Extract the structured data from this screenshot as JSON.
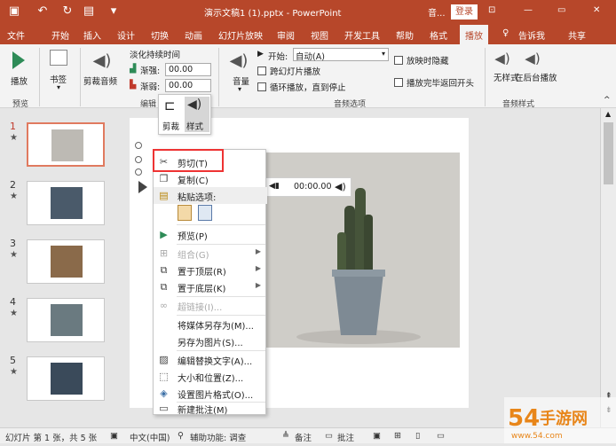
{
  "titlebar": {
    "doc_title": "演示文稿1 (1).pptx - PowerPoint",
    "tools_label": "音...",
    "login": "登录",
    "min": "—",
    "restore": "▭",
    "close": "✕"
  },
  "tabs": [
    "文件",
    "开始",
    "插入",
    "设计",
    "切换",
    "动画",
    "幻灯片放映",
    "审阅",
    "视图",
    "开发工具",
    "帮助",
    "格式",
    "播放"
  ],
  "tell_me": "告诉我",
  "share": "共享",
  "ribbon": {
    "play": "播放",
    "bookmark": "书签",
    "trim": "剪裁音频",
    "fade_title": "淡化持续时间",
    "fade_in": "渐强:",
    "fade_out": "渐弱:",
    "fade_in_value": "00.00",
    "fade_out_value": "00.00",
    "volume": "音量",
    "start_label": "开始:",
    "start_value": "自动(A)",
    "cross_slides": "跨幻灯片播放",
    "loop": "循环播放，直到停止",
    "hide": "放映时隐藏",
    "rewind": "播放完毕返回开头",
    "no_style": "无样式",
    "play_bg": "在后台播放",
    "group_preview": "预览",
    "group_edit": "编辑",
    "group_audio_options": "音频选项",
    "group_audio_style": "音频样式"
  },
  "mini_toolbar": {
    "crop": "剪裁",
    "style": "样式"
  },
  "slides": [
    {
      "num": "1",
      "mark": "★"
    },
    {
      "num": "2",
      "mark": "★"
    },
    {
      "num": "3",
      "mark": "★"
    },
    {
      "num": "4",
      "mark": "★"
    },
    {
      "num": "5",
      "mark": "★"
    }
  ],
  "media": {
    "time": "00:00.00"
  },
  "context_menu": [
    {
      "label": "剪切(T)",
      "icon": "scissors-icon"
    },
    {
      "label": "复制(C)",
      "icon": "copy-icon"
    },
    {
      "label": "粘贴选项:",
      "icon": "paste-icon"
    },
    {
      "label": "预览(P)",
      "icon": "play-icon"
    },
    {
      "label": "组合(G)",
      "icon": "group-icon"
    },
    {
      "label": "置于顶层(R)",
      "icon": "bring-front-icon"
    },
    {
      "label": "置于底层(K)",
      "icon": "send-back-icon"
    },
    {
      "label": "超链接(I)...",
      "icon": "link-icon"
    },
    {
      "label": "将媒体另存为(M)...",
      "icon": ""
    },
    {
      "label": "另存为图片(S)...",
      "icon": ""
    },
    {
      "label": "编辑替换文字(A)...",
      "icon": "alt-text-icon"
    },
    {
      "label": "大小和位置(Z)...",
      "icon": "size-icon"
    },
    {
      "label": "设置图片格式(O)...",
      "icon": "format-icon"
    },
    {
      "label": "新建批注(M)",
      "icon": "comment-icon"
    }
  ],
  "status": {
    "slide_info": "幻灯片 第 1 张，共 5 张",
    "lang": "中文(中国)",
    "accessibility": "辅助功能: 调查",
    "notes": "备注",
    "comments": "批注"
  },
  "watermark": {
    "text": "54手游网",
    "sub": "www.54.com"
  },
  "colors": {
    "accent": "#b7472a",
    "highlight": "#e33333"
  }
}
